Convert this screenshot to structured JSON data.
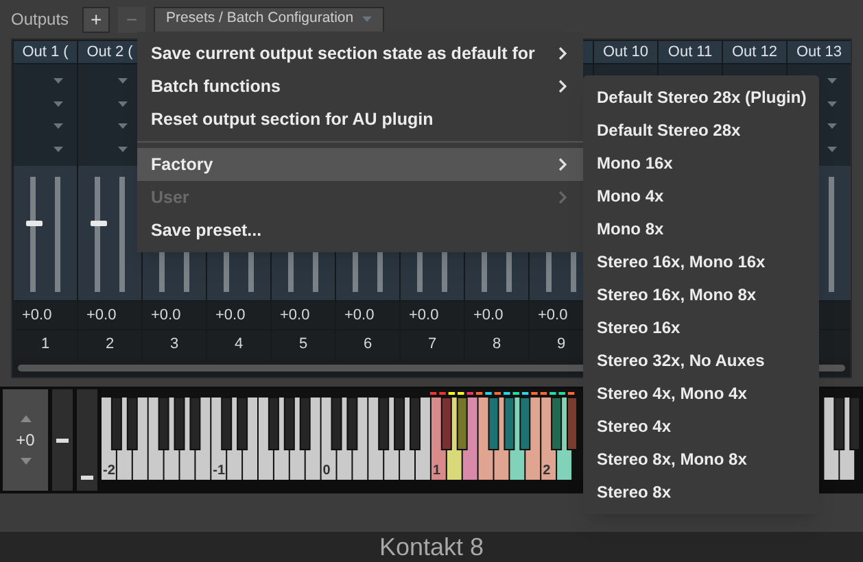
{
  "toolbar": {
    "label": "Outputs",
    "add": "+",
    "remove": "−",
    "presets": "Presets / Batch Configuration"
  },
  "channels": [
    {
      "header": "Out 1 (",
      "level": 0.6,
      "gain": "+0.0",
      "number": "1"
    },
    {
      "header": "Out 2 (",
      "level": 0.6,
      "gain": "+0.0",
      "number": "2"
    },
    {
      "gain": "+0.0",
      "number": "3"
    },
    {
      "gain": "+0.0",
      "number": "4"
    },
    {
      "gain": "+0.0",
      "number": "5"
    },
    {
      "gain": "+0.0",
      "number": "6"
    },
    {
      "gain": "+0.0",
      "number": "7"
    },
    {
      "gain": "+0.0",
      "number": "8"
    },
    {
      "gain": "+0.0",
      "number": "9"
    },
    {
      "header": "Out 10"
    },
    {
      "header": "Out 11"
    },
    {
      "header": "Out 12"
    },
    {
      "header": "Out 13"
    }
  ],
  "transpose": "+0",
  "keyboard": {
    "octave_labels": [
      "-2",
      "-1",
      "0",
      "1",
      "2"
    ],
    "colored_white_keys": [
      {
        "color": "#d98a8a"
      },
      {
        "color": "#d9d97a"
      },
      {
        "color": "#d98aa8"
      },
      {
        "color": "#e0a590"
      },
      {
        "color": "#e0a590"
      },
      {
        "color": "#80d2b8"
      },
      {
        "color": "#e0a590"
      },
      {
        "color": "#e0a590"
      },
      {
        "color": "#80d2b8"
      }
    ],
    "colored_black_keys": [
      {
        "color": "#7a3030"
      },
      {
        "color": "#76762a"
      },
      {
        "color": "#1f7272"
      },
      {
        "color": "#1f7272"
      },
      {
        "color": "#1f7272"
      },
      {
        "color": "#1f6a50"
      },
      {
        "color": "#7a3e30"
      }
    ],
    "markers": [
      {
        "color": "#ff3030"
      },
      {
        "color": "#ff3030"
      },
      {
        "color": "#ffff20"
      },
      {
        "color": "#ffff20"
      },
      {
        "color": "#ff3070"
      },
      {
        "color": "#ff6a30"
      },
      {
        "color": "#20d8f0"
      },
      {
        "color": "#ff6a30"
      },
      {
        "color": "#20d8f0"
      },
      {
        "color": "#20e0a0"
      },
      {
        "color": "#20d8f0"
      },
      {
        "color": "#ff6a30"
      },
      {
        "color": "#ff6a30"
      },
      {
        "color": "#20e0a0"
      },
      {
        "color": "#20e0a0"
      },
      {
        "color": "#ff6a30"
      }
    ]
  },
  "menu": [
    {
      "kind": "item",
      "label": "Save current output section state as default for",
      "submenu": true,
      "disabled": false,
      "selected": false
    },
    {
      "kind": "item",
      "label": "Batch functions",
      "submenu": true,
      "disabled": false,
      "selected": false
    },
    {
      "kind": "item",
      "label": "Reset output section for AU plugin",
      "submenu": false,
      "disabled": false,
      "selected": false
    },
    {
      "kind": "separator"
    },
    {
      "kind": "item",
      "label": "Factory",
      "submenu": true,
      "disabled": false,
      "selected": true
    },
    {
      "kind": "item",
      "label": "User",
      "submenu": true,
      "disabled": true,
      "selected": false
    },
    {
      "kind": "item",
      "label": "Save preset...",
      "submenu": false,
      "disabled": false,
      "selected": false
    }
  ],
  "submenu": [
    "Default Stereo 28x (Plugin)",
    "Default Stereo 28x",
    "Mono 16x",
    "Mono 4x",
    "Mono 8x",
    "Stereo 16x, Mono 16x",
    "Stereo 16x, Mono 8x",
    "Stereo 16x",
    "Stereo 32x, No Auxes",
    "Stereo 4x, Mono 4x",
    "Stereo 4x",
    "Stereo 8x, Mono 8x",
    "Stereo 8x"
  ],
  "footer": "Kontakt 8"
}
